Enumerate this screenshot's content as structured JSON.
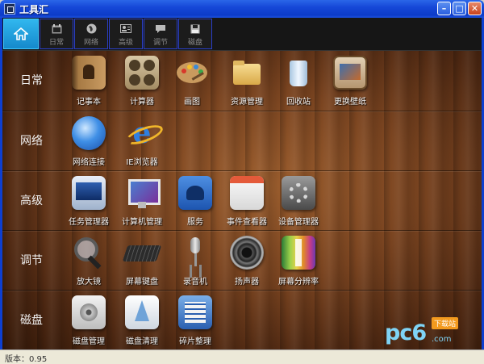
{
  "window": {
    "title": "工具汇",
    "minimize": "–",
    "maximize": "□",
    "close": "✕"
  },
  "toolbar": {
    "tabs": [
      {
        "label": "",
        "icon": "home-icon"
      },
      {
        "label": "日常",
        "icon": "calendar-icon"
      },
      {
        "label": "网络",
        "icon": "globe-icon"
      },
      {
        "label": "高级",
        "icon": "id-card-icon"
      },
      {
        "label": "调节",
        "icon": "chat-bubble-icon"
      },
      {
        "label": "磁盘",
        "icon": "floppy-disk-icon"
      }
    ]
  },
  "rows": [
    {
      "label": "日常",
      "items": [
        {
          "label": "记事本",
          "icon": "notebook-icon"
        },
        {
          "label": "计算器",
          "icon": "calculator-icon"
        },
        {
          "label": "画图",
          "icon": "paint-palette-icon"
        },
        {
          "label": "资源管理",
          "icon": "folder-icon"
        },
        {
          "label": "回收站",
          "icon": "recycle-bin-icon"
        },
        {
          "label": "更换壁纸",
          "icon": "wallpaper-icon"
        }
      ]
    },
    {
      "label": "网络",
      "items": [
        {
          "label": "网络连接",
          "icon": "network-globe-icon"
        },
        {
          "label": "IE浏览器",
          "icon": "ie-browser-icon"
        }
      ]
    },
    {
      "label": "高级",
      "items": [
        {
          "label": "任务管理器",
          "icon": "task-manager-icon"
        },
        {
          "label": "计算机管理",
          "icon": "computer-icon"
        },
        {
          "label": "服务",
          "icon": "services-icon"
        },
        {
          "label": "事件查看器",
          "icon": "event-viewer-icon"
        },
        {
          "label": "设备管理器",
          "icon": "device-manager-icon"
        }
      ]
    },
    {
      "label": "调节",
      "items": [
        {
          "label": "放大镜",
          "icon": "magnifier-icon"
        },
        {
          "label": "屏幕键盘",
          "icon": "keyboard-icon"
        },
        {
          "label": "录音机",
          "icon": "microphone-icon"
        },
        {
          "label": "扬声器",
          "icon": "speaker-icon"
        },
        {
          "label": "屏幕分辨率",
          "icon": "resolution-icon"
        }
      ]
    },
    {
      "label": "磁盘",
      "items": [
        {
          "label": "磁盘管理",
          "icon": "disk-icon"
        },
        {
          "label": "磁盘清理",
          "icon": "disk-cleanup-icon"
        },
        {
          "label": "碎片整理",
          "icon": "defrag-icon"
        }
      ]
    }
  ],
  "watermark": {
    "brand": "pc6",
    "suffix": ".com",
    "badge": "下载站"
  },
  "status": {
    "version": "版本：0.95"
  },
  "colors": {
    "title_bar": "#0c3bc8",
    "home_tab": "#1589cc",
    "toolbar_bg": "#161616",
    "tab_border": "#2a3fc8"
  }
}
